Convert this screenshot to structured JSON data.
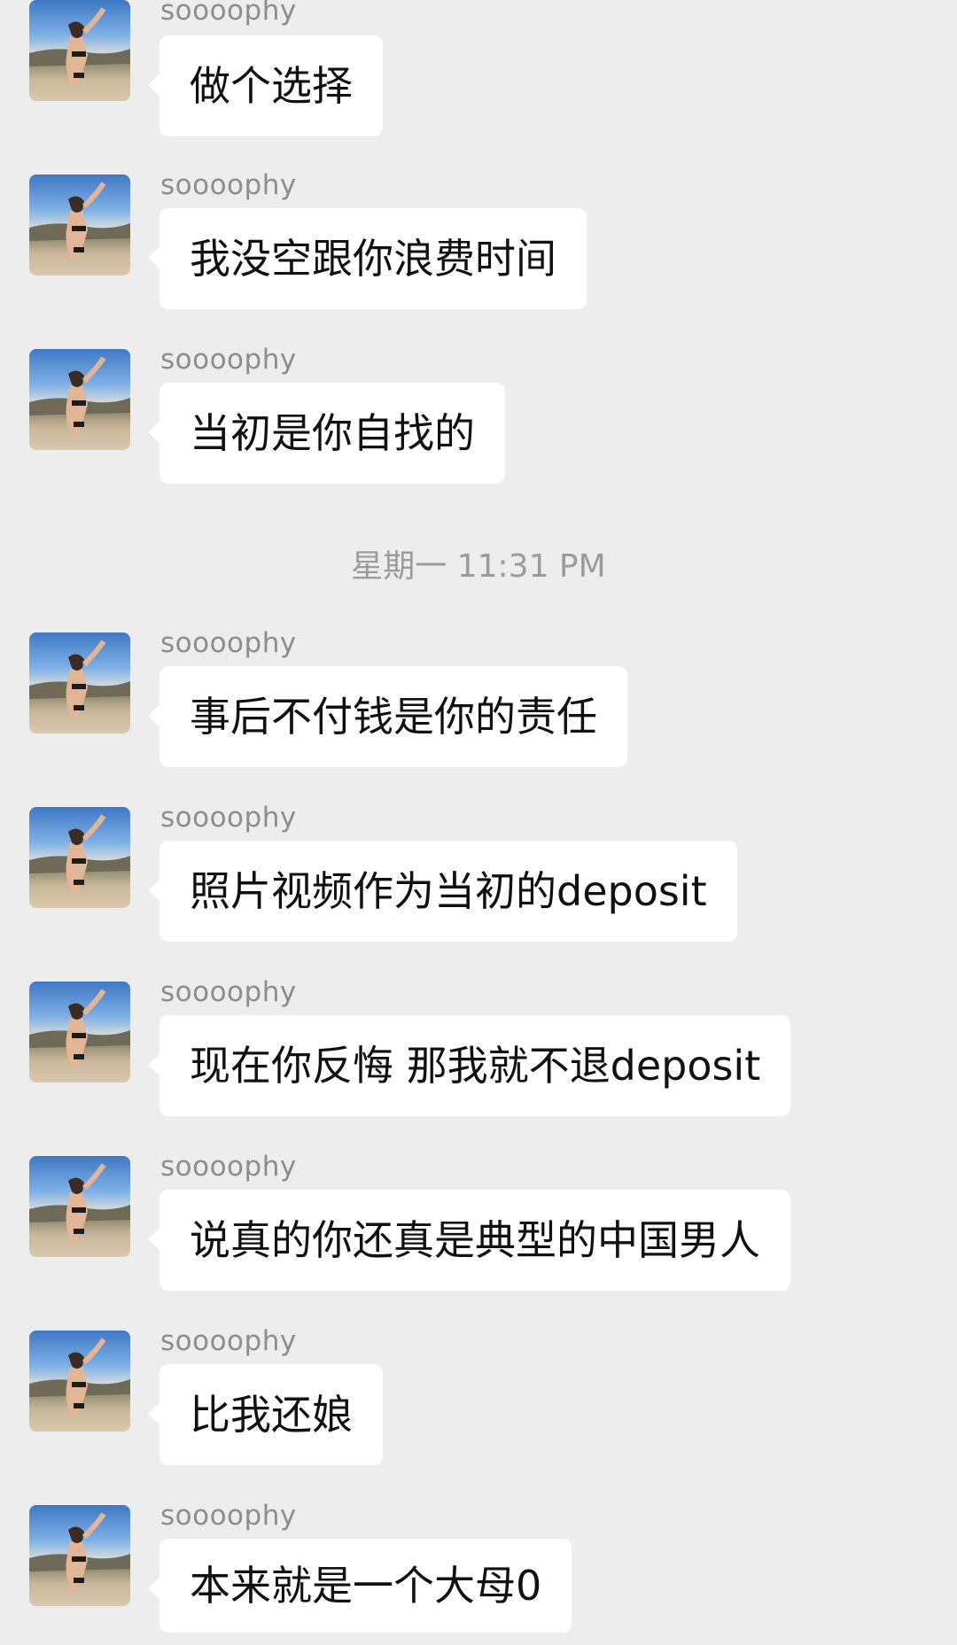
{
  "conversation": {
    "timestamp": "星期一 11:31 PM",
    "messages": [
      {
        "sender": "soooophy",
        "text": "做个选择"
      },
      {
        "sender": "soooophy",
        "text": "我没空跟你浪费时间"
      },
      {
        "sender": "soooophy",
        "text": "当初是你自找的"
      },
      {
        "sender": "soooophy",
        "text": "事后不付钱是你的责任"
      },
      {
        "sender": "soooophy",
        "text": "照片视频作为当初的deposit"
      },
      {
        "sender": "soooophy",
        "text": "现在你反悔 那我就不退deposit"
      },
      {
        "sender": "soooophy",
        "text": "说真的你还真是典型的中国男人"
      },
      {
        "sender": "soooophy",
        "text": "比我还娘"
      },
      {
        "sender": "soooophy",
        "text": "本来就是一个大母0"
      }
    ]
  },
  "colors": {
    "background": "#ededed",
    "bubble": "#ffffff",
    "sender_text": "#8d8d8d",
    "timestamp_text": "#9b9b9b",
    "message_text": "#111111"
  },
  "icons": {
    "avatar": "avatar-photo-beach"
  }
}
